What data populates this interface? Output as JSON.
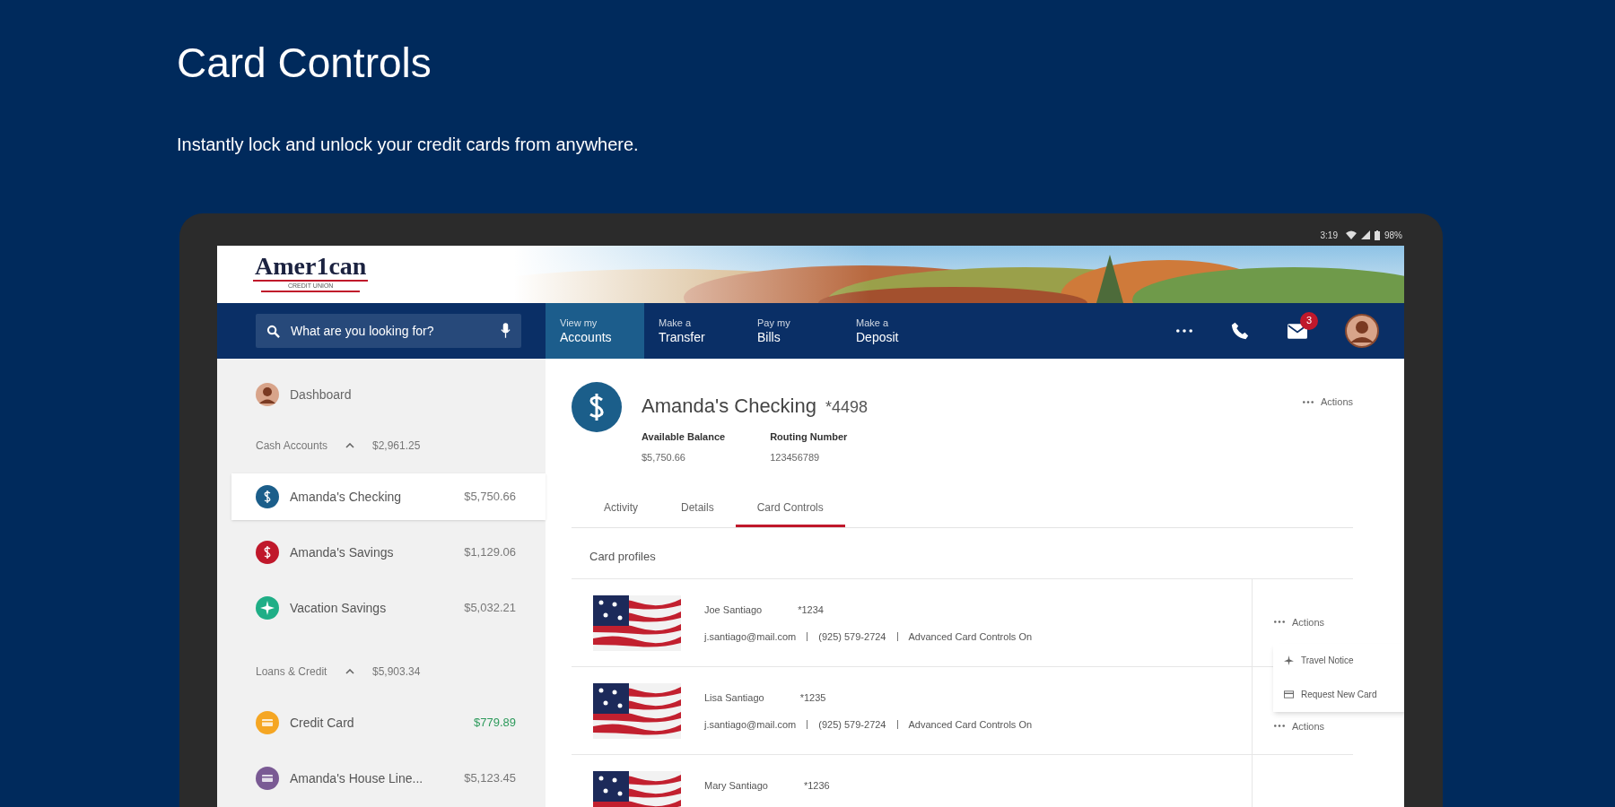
{
  "promo": {
    "title": "Card Controls",
    "subtitle": "Instantly lock and unlock your credit cards from anywhere."
  },
  "status_bar": {
    "time": "3:19",
    "battery": "98%"
  },
  "logo": {
    "name": "Amer1can",
    "tagline": "CREDIT UNION"
  },
  "search": {
    "placeholder": "What are you looking for?"
  },
  "nav": [
    {
      "line1": "View my",
      "line2": "Accounts",
      "selected": true
    },
    {
      "line1": "Make a",
      "line2": "Transfer",
      "selected": false
    },
    {
      "line1": "Pay my",
      "line2": "Bills",
      "selected": false
    },
    {
      "line1": "Make a",
      "line2": "Deposit",
      "selected": false
    }
  ],
  "messages_badge": "3",
  "sidebar": {
    "dashboard": "Dashboard",
    "groups": [
      {
        "label": "Cash Accounts",
        "total": "$2,961.25",
        "expanded": true,
        "accounts": [
          {
            "name": "Amanda's Checking",
            "balance": "$5,750.66",
            "color": "#1b5e8a",
            "kind": "dollar",
            "positive": false,
            "selected": true
          },
          {
            "name": "Amanda's Savings",
            "balance": "$1,129.06",
            "color": "#c0182b",
            "kind": "dollar",
            "positive": false,
            "selected": false
          },
          {
            "name": "Vacation Savings",
            "balance": "$5,032.21",
            "color": "#1fae86",
            "kind": "plane",
            "positive": false,
            "selected": false
          }
        ]
      },
      {
        "label": "Loans & Credit",
        "total": "$5,903.34",
        "expanded": true,
        "accounts": [
          {
            "name": "Credit Card",
            "balance": "$779.89",
            "color": "#f5a623",
            "kind": "card",
            "positive": true,
            "selected": false
          },
          {
            "name": "Amanda's House Line...",
            "balance": "$5,123.45",
            "color": "#7a5a94",
            "kind": "card",
            "positive": false,
            "selected": false
          }
        ]
      }
    ]
  },
  "account": {
    "title": "Amanda's Checking",
    "number": "*4498",
    "actions": "Actions",
    "fields": [
      {
        "label": "Available Balance",
        "value": "$5,750.66"
      },
      {
        "label": "Routing Number",
        "value": "123456789"
      }
    ]
  },
  "tabs": [
    {
      "label": "Activity",
      "selected": false
    },
    {
      "label": "Details",
      "selected": false
    },
    {
      "label": "Card Controls",
      "selected": true
    }
  ],
  "card_profiles": {
    "heading": "Card profiles",
    "rows": [
      {
        "name": "Joe Santiago",
        "card": "*1234",
        "email": "j.santiago@mail.com",
        "phone": "(925) 579-2724",
        "status": "Advanced Card Controls On",
        "actions": "Actions",
        "menu_open": true
      },
      {
        "name": "Lisa Santiago",
        "card": "*1235",
        "email": "j.santiago@mail.com",
        "phone": "(925) 579-2724",
        "status": "Advanced Card Controls On",
        "actions": "Actions",
        "menu_open": false
      },
      {
        "name": "Mary Santiago",
        "card": "*1236",
        "menu_open": false
      }
    ]
  },
  "actions_menu": {
    "items": [
      {
        "label": "Travel Notice",
        "kind": "plane"
      },
      {
        "label": "Request New Card",
        "kind": "card"
      }
    ]
  }
}
